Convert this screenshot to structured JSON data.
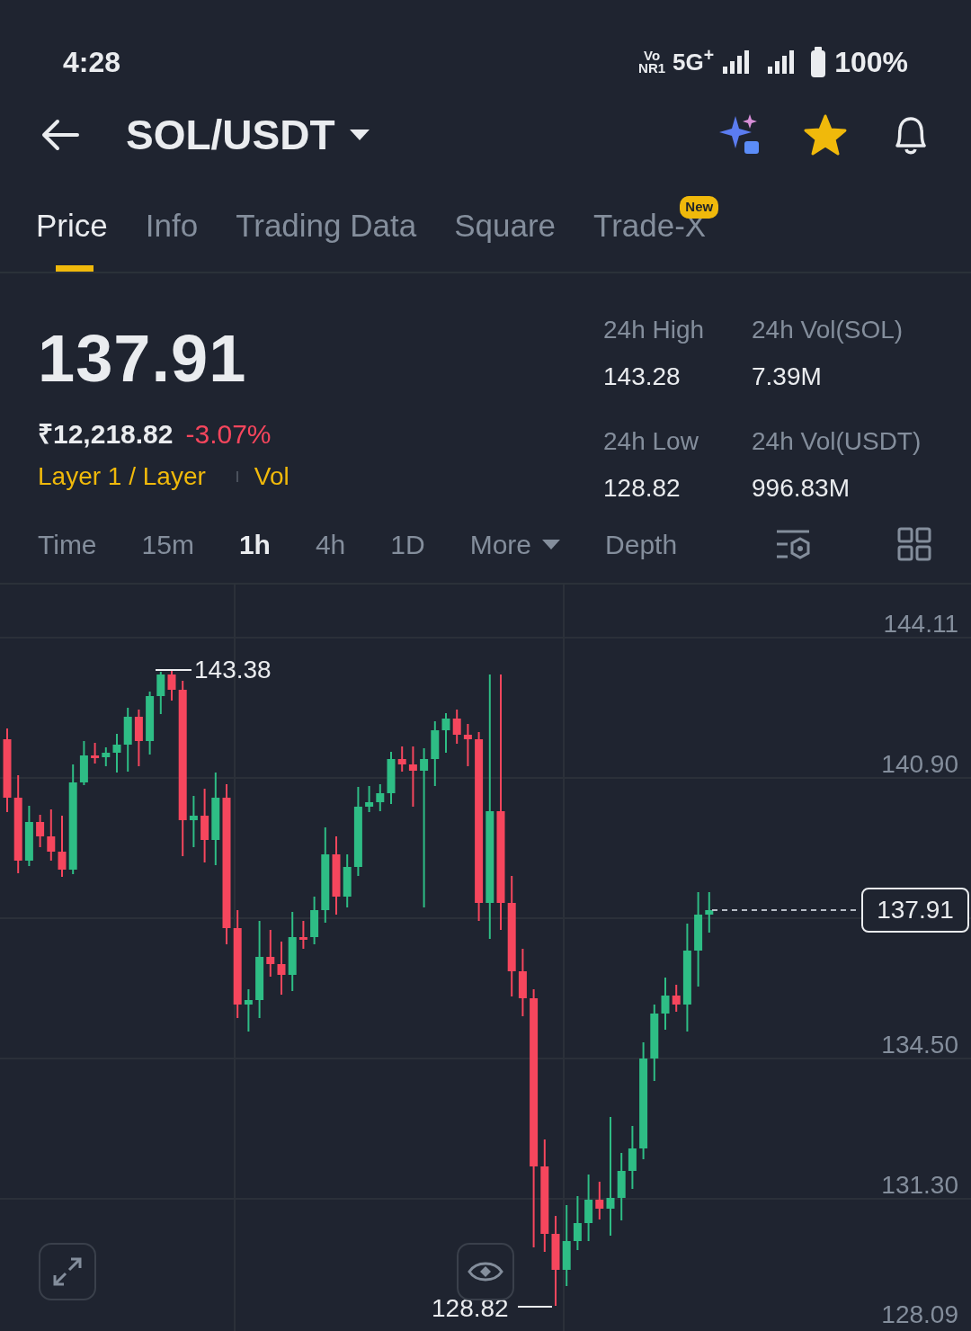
{
  "status_bar": {
    "time": "4:28",
    "vonr_top": "Vo",
    "vonr_bottom": "NR1",
    "network": "5G$^{+}$",
    "battery": "100%"
  },
  "header": {
    "pair": "SOL/USDT",
    "favorite": true
  },
  "tabs": [
    {
      "label": "Price",
      "selected": true
    },
    {
      "label": "Info",
      "selected": false
    },
    {
      "label": "Trading Data",
      "selected": false
    },
    {
      "label": "Square",
      "selected": false
    },
    {
      "label": "Trade-X",
      "selected": false,
      "badge": "New"
    }
  ],
  "price": {
    "last": "137.91",
    "fiat": "₹12,218.82",
    "change": "-3.07%",
    "tags": [
      "Layer 1 / Layer",
      "Vol"
    ]
  },
  "stats": [
    {
      "label": "24h High",
      "value": "143.28"
    },
    {
      "label": "24h Vol(SOL)",
      "value": "7.39M"
    },
    {
      "label": "24h Low",
      "value": "128.82"
    },
    {
      "label": "24h Vol(USDT)",
      "value": "996.83M"
    }
  ],
  "intervals": [
    {
      "label": "Time",
      "kind": "interval",
      "selected": false
    },
    {
      "label": "15m",
      "kind": "interval",
      "selected": false
    },
    {
      "label": "1h",
      "kind": "interval",
      "selected": true
    },
    {
      "label": "4h",
      "kind": "interval",
      "selected": false
    },
    {
      "label": "1D",
      "kind": "interval",
      "selected": false
    },
    {
      "label": "More",
      "kind": "dropdown",
      "selected": false
    },
    {
      "label": "Depth",
      "kind": "interval",
      "selected": false
    }
  ],
  "chart": {
    "price_axis": [
      "144.11",
      "140.90",
      "134.50",
      "131.30",
      "128.09"
    ],
    "current_price": "137.91",
    "high_marker": "143.38",
    "low_marker": "128.82"
  }
}
